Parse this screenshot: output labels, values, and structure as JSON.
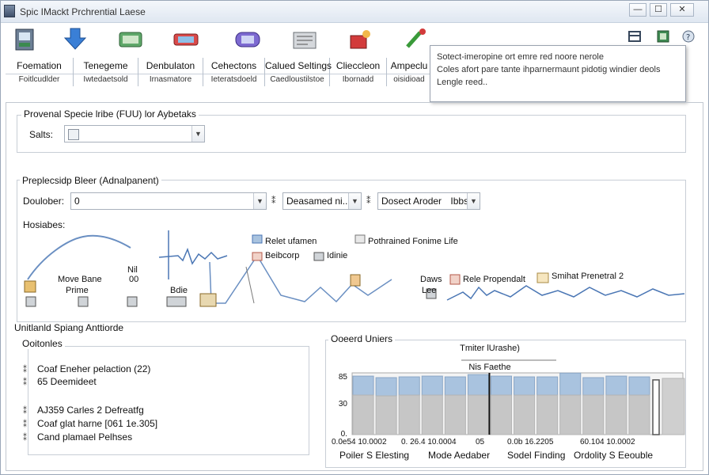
{
  "window": {
    "title": "Spic IMackt Prchrential Laese",
    "min": "—",
    "max": "☐",
    "close": "✕"
  },
  "toolbar": {
    "icons": [
      "device-icon",
      "download-icon",
      "network-icon",
      "transfer-icon",
      "meter-icon",
      "document-icon",
      "alert-icon",
      "tools-icon"
    ]
  },
  "tabs": [
    {
      "label": "Foemation",
      "sub": "Foitlcudlder"
    },
    {
      "label": "Tenegeme",
      "sub": "Iwtedaetsold"
    },
    {
      "label": "Denbulaton",
      "sub": "Irnasmatore"
    },
    {
      "label": "Cehectons",
      "sub": "Ieteratsdoeld"
    },
    {
      "label": "Calued Seltings",
      "sub": "Caedloustilstoe"
    },
    {
      "label": "Clieccleon",
      "sub": "Ibornadd"
    },
    {
      "label": "Ampeclu",
      "sub": "oisidioad"
    }
  ],
  "tooltip": {
    "lines": [
      "Sotect-imeropine ort emre red noore nerole",
      "Coles afort pare tante ihparnermaunt pidotig windier deols",
      "Lengle reed.."
    ]
  },
  "section1": {
    "title": "Provenal Specie lribe (FUU) lor Aybetaks",
    "salts_label": "Salts:"
  },
  "section2": {
    "title": "Preplecsidp Bleer (Adnalpanent)",
    "doulober_label": "Doulober:",
    "doulober_value": "0",
    "combo2_value": "Deasamed ni..",
    "combo3_value": "Dosect Aroder",
    "combo3_extra": "Ibbs",
    "hosiabes_label": "Hosiabes:",
    "diagram": {
      "labels": {
        "move_bane": "Move Bane",
        "prime": "Prime",
        "nh": "Nil",
        "n0": "00",
        "bdit": "Bdie",
        "relet": "Relet ufamen",
        "beibcorp": "Beibcorp",
        "idlnie": "Idinie",
        "pothrained": "Pothrained Fonime Life",
        "daws": "Daws",
        "le": "Lee",
        "rele": "Rele Propendalt",
        "smihat": "Smihat Prenetral 2"
      }
    }
  },
  "section3": {
    "title": "Unitlanld Spiang Anttiorde",
    "outcomes_title": "Ooitonles",
    "items": [
      "Coaf Eneher pelaction (22)",
      "65 Deemideet",
      "AJ359 Carles 2 Defreatfg",
      "Coaf glat harne [061 1e.305]",
      "Cand plamael Pelhses"
    ],
    "overall_title": "Ooeerd Uniers"
  },
  "chart_data": {
    "type": "bar",
    "title": "Tmiter lUrashe)",
    "subtitle": "Nis Faethe",
    "y_ticks": [
      "85",
      "30",
      "0."
    ],
    "x_tick_labels": [
      "0.0e54 10.0002",
      "0. 26.4 10.0004",
      "05",
      "0.0b 16.2205",
      "60.104 10.0002"
    ],
    "x_groups": [
      "Poiler S Elesting",
      "Mode Aedaber",
      "Sodel Finding",
      "Ordolity S Eeouble"
    ],
    "ylim": [
      0,
      100
    ],
    "values_total": [
      77,
      75,
      76,
      77,
      76,
      79,
      77,
      76,
      76,
      81,
      75,
      77,
      76
    ],
    "values_lower": [
      52,
      51,
      52,
      52,
      52,
      52,
      52,
      52,
      52,
      52,
      52,
      52,
      52
    ],
    "colors": {
      "upper": "#a9c3df",
      "lower": "#c6c6c6",
      "outline": "#555555"
    }
  }
}
